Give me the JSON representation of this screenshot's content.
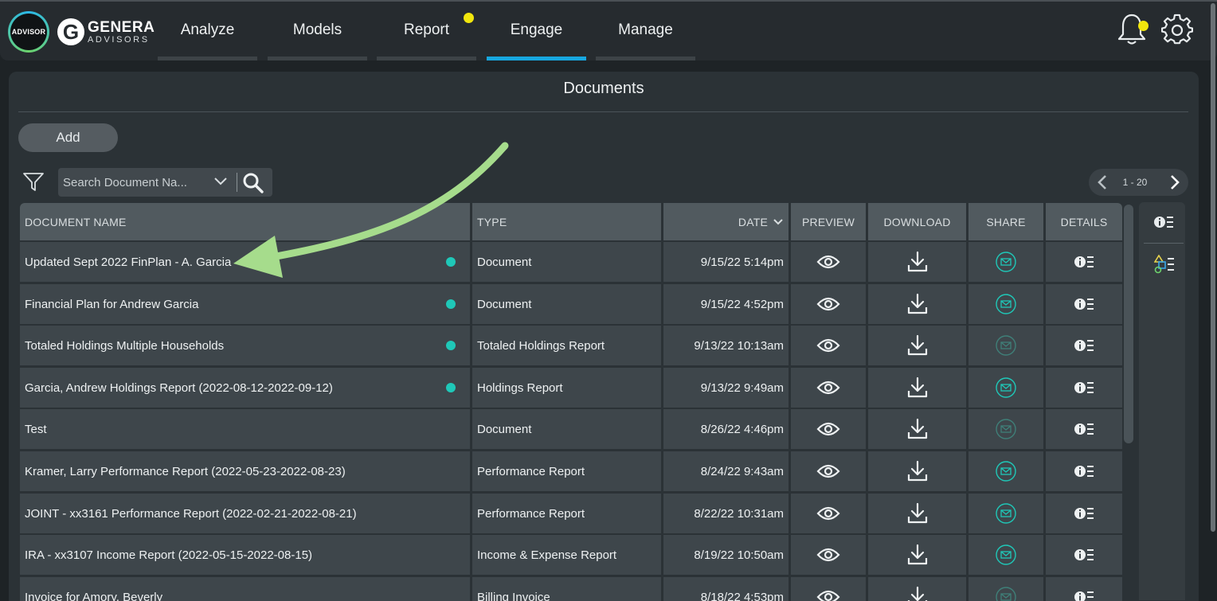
{
  "app": {
    "logo_advisor": "ADVISOR",
    "logo_brand_main": "GENERA",
    "logo_brand_sub": "ADVISORS",
    "logo_brand_letter": "G"
  },
  "nav": {
    "tabs": [
      {
        "label": "Analyze"
      },
      {
        "label": "Models"
      },
      {
        "label": "Report"
      },
      {
        "label": "Engage"
      },
      {
        "label": "Manage"
      }
    ],
    "active_tab": "Engage"
  },
  "page": {
    "title": "Documents",
    "add_label": "Add",
    "search_placeholder": "Search Document Na...",
    "pager_text": "1 - 20"
  },
  "table": {
    "columns": [
      {
        "label": "DOCUMENT NAME"
      },
      {
        "label": "TYPE"
      },
      {
        "label": "DATE"
      },
      {
        "label": "PREVIEW"
      },
      {
        "label": "DOWNLOAD"
      },
      {
        "label": "SHARE"
      },
      {
        "label": "DETAILS"
      }
    ],
    "rows": [
      {
        "name": "Updated Sept 2022 FinPlan - A. Garcia",
        "type": "Document",
        "date": "9/15/22 5:14pm",
        "new": true,
        "shareable": true
      },
      {
        "name": "Financial Plan for Andrew Garcia",
        "type": "Document",
        "date": "9/15/22 4:52pm",
        "new": true,
        "shareable": true
      },
      {
        "name": "Totaled Holdings Multiple Households",
        "type": "Totaled Holdings Report",
        "date": "9/13/22 10:13am",
        "new": true,
        "shareable": false
      },
      {
        "name": "Garcia, Andrew Holdings Report (2022-08-12-2022-09-12)",
        "type": "Holdings Report",
        "date": "9/13/22 9:49am",
        "new": true,
        "shareable": true
      },
      {
        "name": "Test",
        "type": "Document",
        "date": "8/26/22 4:46pm",
        "new": false,
        "shareable": false
      },
      {
        "name": "Kramer, Larry Performance Report (2022-05-23-2022-08-23)",
        "type": "Performance Report",
        "date": "8/24/22 9:43am",
        "new": false,
        "shareable": true
      },
      {
        "name": "JOINT - xx3161 Performance Report (2022-02-21-2022-08-21)",
        "type": "Performance Report",
        "date": "8/22/22 10:31am",
        "new": false,
        "shareable": true
      },
      {
        "name": "IRA - xx3107 Income Report (2022-05-15-2022-08-15)",
        "type": "Income & Expense Report",
        "date": "8/19/22 10:50am",
        "new": false,
        "shareable": true
      },
      {
        "name": "Invoice for Amory, Beverly",
        "type": "Billing Invoice",
        "date": "8/18/22 4:53pm",
        "new": false,
        "shareable": false
      }
    ]
  },
  "colors": {
    "accent_tab": "#17a7e0",
    "notification_dot": "#f1e60d",
    "new_dot": "#1fc8b8",
    "share_active": "#1fc8b8",
    "share_inactive": "#3f7f78",
    "annotation_arrow": "#a6dc8c"
  },
  "icons": {
    "nav": [
      "bell-icon",
      "gear-icon"
    ],
    "toolbar": [
      "filter-icon",
      "chevron-down-icon",
      "search-icon",
      "chevron-left-icon",
      "chevron-right-icon"
    ],
    "row": [
      "eye-icon",
      "download-icon",
      "mail-icon",
      "info-list-icon"
    ],
    "rail": [
      "info-list-icon",
      "shapes-list-icon"
    ]
  }
}
